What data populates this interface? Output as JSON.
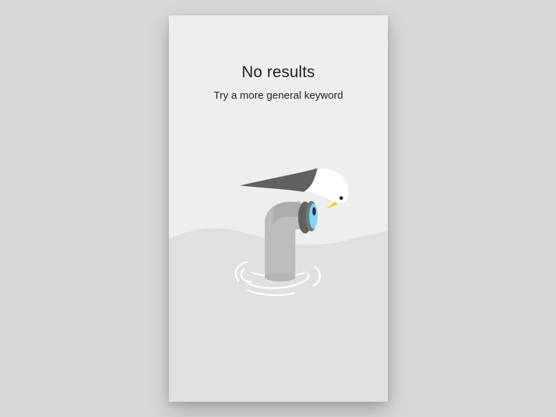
{
  "empty_state": {
    "title": "No results",
    "message": "Try a more general keyword"
  },
  "colors": {
    "page_background": "#d8d8d8",
    "card_background": "#eeeeee",
    "water": "#e0e0e0",
    "pipe": "#bdbdbd",
    "lens_rim": "#616161",
    "lens_glass": "#81d4fa",
    "bird_wing": "#616161",
    "bird_body": "#ffffff",
    "beak": "#fbc02d",
    "text": "#222222"
  },
  "illustration": {
    "icon": "seagull-on-periscope-icon"
  }
}
